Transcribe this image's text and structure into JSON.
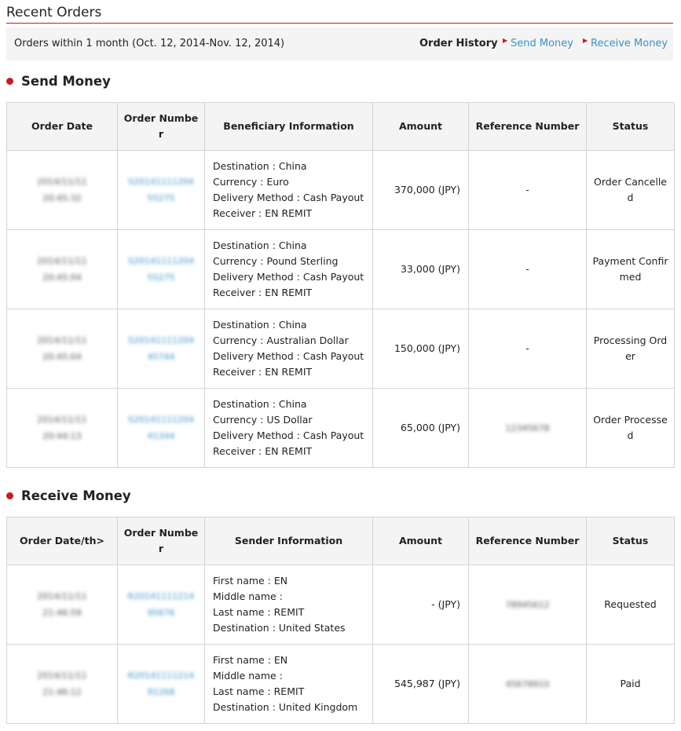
{
  "title": "Recent Orders",
  "filter": {
    "text": "Orders within 1 month (Oct. 12, 2014-Nov. 12, 2014)",
    "history_label": "Order History",
    "link_send": "Send Money",
    "link_receive": "Receive Money"
  },
  "send": {
    "heading": "Send Money",
    "headers": [
      "Order Date",
      "Order Numbe\nr",
      "Beneficiary Information",
      "Amount",
      "Reference Number",
      "Status"
    ],
    "rows": [
      {
        "date": "2014/11/11\n20:45:32",
        "order": "S20141111204\n55275",
        "info": [
          "Destination : China",
          "Currency : Euro",
          "Delivery Method : Cash Payout",
          "Receiver : EN REMIT"
        ],
        "amount": "370,000 (JPY)",
        "ref": "-",
        "status": "Order Cancelle\nd"
      },
      {
        "date": "2014/11/11\n20:45:04",
        "order": "S20141111204\n55275",
        "info": [
          "Destination : China",
          "Currency : Pound Sterling",
          "Delivery Method : Cash Payout",
          "Receiver : EN REMIT"
        ],
        "amount": "33,000 (JPY)",
        "ref": "-",
        "status": "Payment Confir\nmed"
      },
      {
        "date": "2014/11/11\n20:45:04",
        "order": "S20141111204\n45744",
        "info": [
          "Destination : China",
          "Currency : Australian Dollar",
          "Delivery Method : Cash Payout",
          "Receiver : EN REMIT"
        ],
        "amount": "150,000 (JPY)",
        "ref": "-",
        "status": "Processing Ord\ner"
      },
      {
        "date": "2014/11/11\n20:44:13",
        "order": "S20141111204\n41344",
        "info": [
          "Destination : China",
          "Currency : US Dollar",
          "Delivery Method : Cash Payout",
          "Receiver : EN REMIT"
        ],
        "amount": "65,000 (JPY)",
        "ref": "12345678",
        "status": "Order Processe\nd"
      }
    ]
  },
  "receive": {
    "heading": "Receive Money",
    "headers": [
      "Order Date/th>",
      "Order Numbe\nr",
      "Sender Information",
      "Amount",
      "Reference Number",
      "Status"
    ],
    "rows": [
      {
        "date": "2014/11/11\n21:46:59",
        "order": "R20141111214\n95676",
        "info": [
          "First name : EN",
          "Middle name :",
          "Last name : REMIT",
          "Destination : United States"
        ],
        "amount": "- (JPY)",
        "ref": "78945612",
        "status": "Requested"
      },
      {
        "date": "2014/11/11\n21:46:12",
        "order": "R20141111214\n91268",
        "info": [
          "First name : EN",
          "Middle name :",
          "Last name : REMIT",
          "Destination : United Kingdom"
        ],
        "amount": "545,987 (JPY)",
        "ref": "45678910",
        "status": "Paid"
      }
    ]
  }
}
